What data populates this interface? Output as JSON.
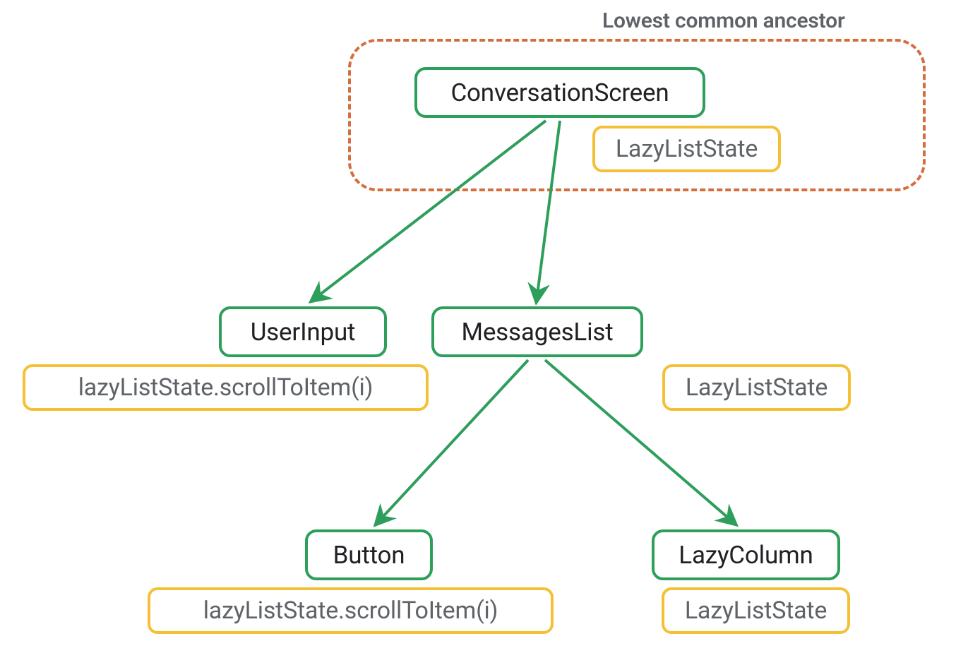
{
  "caption": "Lowest common ancestor",
  "nodes": {
    "conversationScreen": "ConversationScreen",
    "conversationScreenState": "LazyListState",
    "userInput": "UserInput",
    "userInputAction": "lazyListState.scrollToItem(i)",
    "messagesList": "MessagesList",
    "messagesListState": "LazyListState",
    "button": "Button",
    "buttonAction": "lazyListState.scrollToItem(i)",
    "lazyColumn": "LazyColumn",
    "lazyColumnState": "LazyListState"
  },
  "colors": {
    "green": "#2e9e5b",
    "yellow": "#f4c036",
    "dashedOrange": "#d56e3f",
    "textPrimary": "#202124",
    "textSecondary": "#5f6368"
  }
}
